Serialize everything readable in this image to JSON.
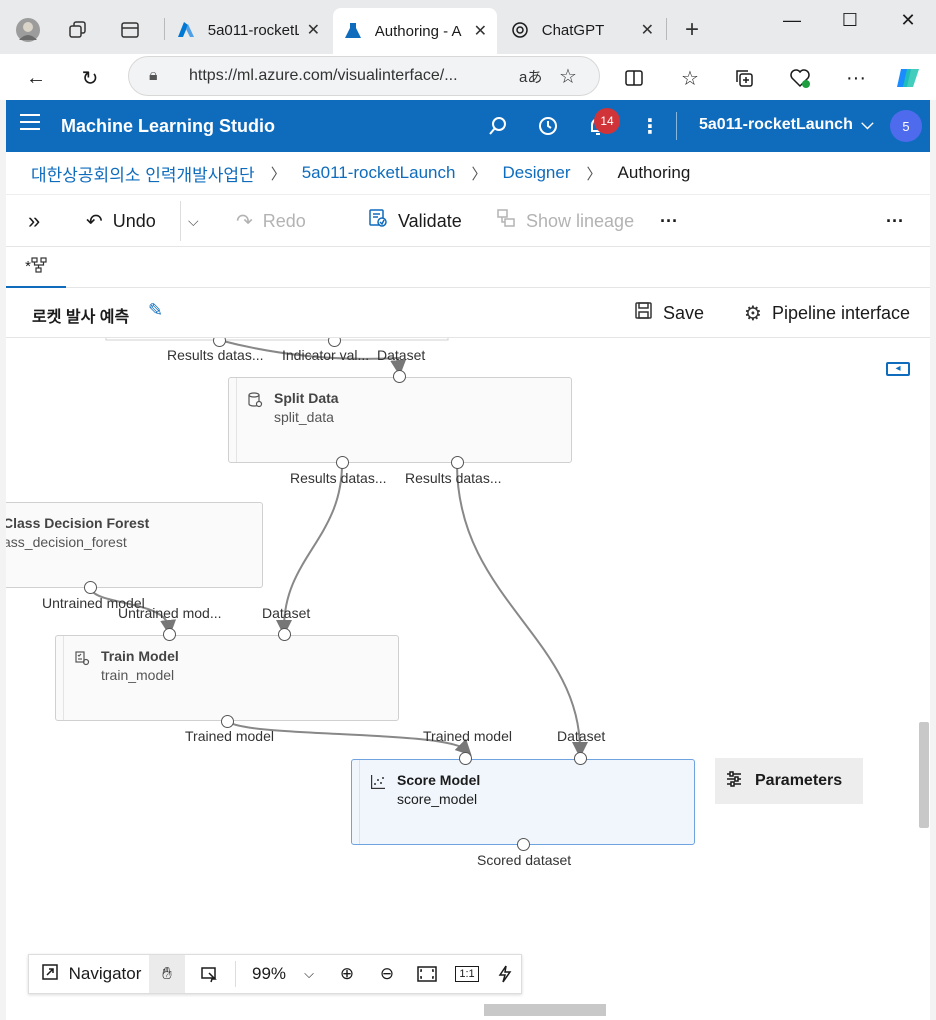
{
  "browser": {
    "tabs": [
      {
        "title": "5a011-rocketL",
        "icon": "azure-logo-icon"
      },
      {
        "title": "Authoring - A",
        "icon": "azure-ml-flask-icon",
        "active": true
      },
      {
        "title": "ChatGPT",
        "icon": "chatgpt-logo-icon"
      }
    ],
    "url": "https://ml.azure.com/visualinterface/...",
    "read_aloud": "aあ"
  },
  "app": {
    "brand": "Machine Learning Studio",
    "notifications": "14",
    "workspace": "5a011-rocketLaunch",
    "avatar": "5",
    "accent": "#0f6cbd"
  },
  "breadcrumb": {
    "items": [
      "대한상공회의소 인력개발사업단",
      "5a011-rocketLaunch",
      "Designer",
      "Authoring"
    ]
  },
  "toolbar": {
    "undo": "Undo",
    "redo": "Redo",
    "validate": "Validate",
    "show_lineage": "Show lineage",
    "more": "···"
  },
  "pipeline": {
    "tab_label": "*",
    "title": "로켓 발사 예측",
    "save": "Save",
    "pipeline_interface": "Pipeline interface"
  },
  "canvas": {
    "top_labels": [
      "Results datas...",
      "Indicator val...",
      "Dataset"
    ],
    "nodes": {
      "split": {
        "name": "Split Data",
        "sub": "split_data",
        "out1": "Results datas...",
        "out2": "Results datas..."
      },
      "forest": {
        "name": "Class Decision Forest",
        "sub": "ass_decision_forest",
        "out": "Untrained model"
      },
      "train": {
        "name": "Train Model",
        "sub": "train_model",
        "in1": "Untrained mod...",
        "in2": "Dataset",
        "out": "Trained model"
      },
      "score": {
        "name": "Score Model",
        "sub": "score_model",
        "in1": "Trained model",
        "in2": "Dataset",
        "out": "Scored dataset"
      }
    },
    "parameters": "Parameters"
  },
  "navigator": {
    "label": "Navigator",
    "zoom": "99%",
    "one_to_one": "1:1"
  }
}
